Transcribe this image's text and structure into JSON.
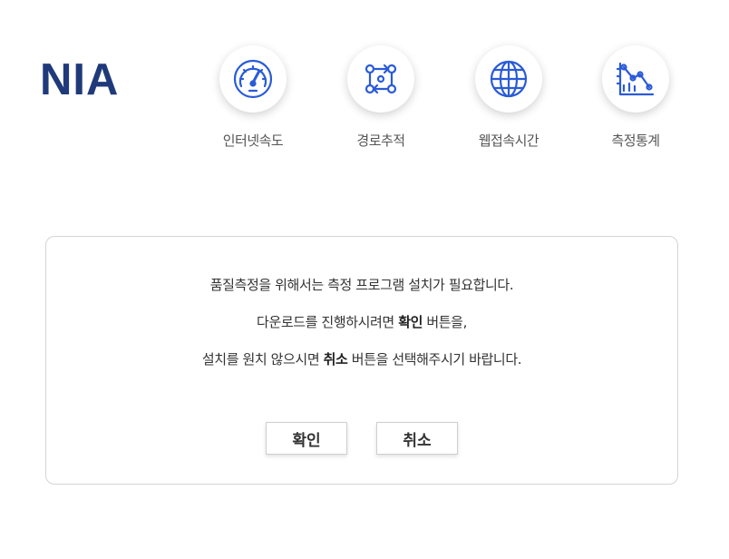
{
  "brand": {
    "logo_text": "NIA"
  },
  "menu": [
    {
      "label": "인터넷속도",
      "icon": "speedometer-icon"
    },
    {
      "label": "경로추적",
      "icon": "route-trace-icon"
    },
    {
      "label": "웹접속시간",
      "icon": "globe-icon"
    },
    {
      "label": "측정통계",
      "icon": "statistics-chart-icon"
    }
  ],
  "dialog": {
    "line1": "품질측정을 위해서는 측정 프로그램 설치가 필요합니다.",
    "line2_before": "다운로드를 진행하시려면 ",
    "line2_bold": "확인",
    "line2_after": " 버튼을,",
    "line3_before": "설치를 원치 않으시면 ",
    "line3_bold": "취소",
    "line3_after": " 버튼을 선택해주시기 바랍니다.",
    "confirm_label": "확인",
    "cancel_label": "취소"
  },
  "colors": {
    "brand": "#1f3a7a",
    "icon": "#2a5bd7"
  }
}
